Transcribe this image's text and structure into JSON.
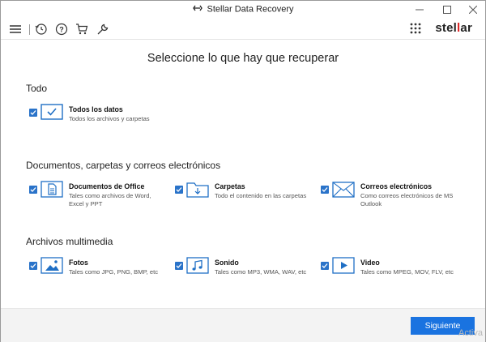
{
  "window": {
    "title": "Stellar Data Recovery"
  },
  "toolbar": {
    "brand_prefix": "stel",
    "brand_accent": "l",
    "brand_suffix": "ar",
    "icons": [
      "hamburger-menu-icon",
      "history-icon",
      "help-icon",
      "cart-icon",
      "wrench-icon",
      "app-grid-icon"
    ]
  },
  "main": {
    "title": "Seleccione lo que hay que recuperar",
    "sections": [
      {
        "title": "Todo",
        "items": [
          {
            "label": "Todos los datos",
            "desc": "Todos los archivos y carpetas",
            "checked": true,
            "icon": "check-window-icon"
          }
        ]
      },
      {
        "title": "Documentos, carpetas y correos electrónicos",
        "items": [
          {
            "label": "Documentos de Office",
            "desc": "Tales como archivos de Word, Excel y PPT",
            "checked": true,
            "icon": "document-icon"
          },
          {
            "label": "Carpetas",
            "desc": "Todo el contenido en las carpetas",
            "checked": true,
            "icon": "folder-icon"
          },
          {
            "label": "Correos electrónicos",
            "desc": "Como correos electrónicos de MS Outlook",
            "checked": true,
            "icon": "envelope-icon"
          }
        ]
      },
      {
        "title": "Archivos multimedia",
        "items": [
          {
            "label": "Fotos",
            "desc": "Tales como JPG, PNG, BMP, etc",
            "checked": true,
            "icon": "photo-icon"
          },
          {
            "label": "Sonido",
            "desc": "Tales como MP3, WMA, WAV, etc",
            "checked": true,
            "icon": "music-icon"
          },
          {
            "label": "Video",
            "desc": "Tales como MPEG, MOV, FLV, etc",
            "checked": true,
            "icon": "video-icon"
          }
        ]
      }
    ]
  },
  "footer": {
    "next_label": "Siguiente",
    "watermark": "Activa"
  },
  "colors": {
    "accent": "#1a73e0",
    "checkbox": "#2a73c9",
    "icon_stroke": "#1f6fc5",
    "brand_red": "#d22222"
  }
}
